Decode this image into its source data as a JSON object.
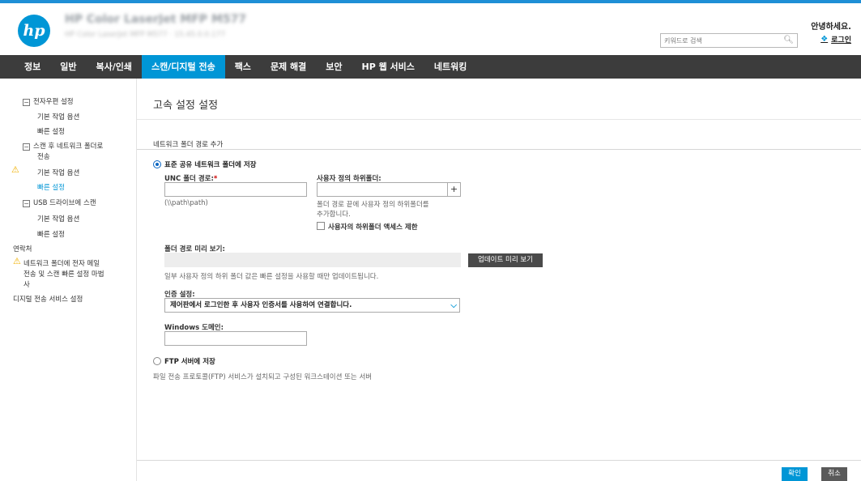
{
  "header": {
    "device_title": "HP Color LaserJet MFP M577",
    "device_subtitle": "HP Color LaserJet MFP M577 · 15.45.0.0.177",
    "greeting": "안녕하세요.",
    "search_placeholder": "키워드로 검색",
    "login_label": "로그인"
  },
  "nav": {
    "items": [
      "정보",
      "일반",
      "복사/인쇄",
      "스캔/디지털 전송",
      "팩스",
      "문제 해결",
      "보안",
      "HP 웹 서비스",
      "네트워킹"
    ],
    "active": "스캔/디지털 전송"
  },
  "sidebar": {
    "items": [
      {
        "label": "전자우편 설정",
        "box": "−"
      },
      {
        "label": "기본 작업 옵션"
      },
      {
        "label": "빠른 설정"
      },
      {
        "label": "스캔 후 네트워크 폴더로",
        "box": "−"
      },
      {
        "label": "전송"
      },
      {
        "label": "기본 작업 옵션",
        "warning": true
      },
      {
        "label": "빠른 설정",
        "active": true
      },
      {
        "label": "USB 드라이브에 스캔",
        "box": "−"
      },
      {
        "label": "기본 작업 옵션"
      },
      {
        "label": "빠른 설정"
      },
      {
        "label": "연락처"
      },
      {
        "label": "네트워크 폴더에 전자 메일",
        "warning": true
      },
      {
        "label": "전송 및 스캔 빠른 설정 마법"
      },
      {
        "label": "사"
      },
      {
        "label": "디지털 전송 서비스 설정"
      }
    ]
  },
  "main": {
    "title": "고속 설정 설정",
    "section_header": "네트워크 폴더 경로 추가",
    "option_standard": "표준 공유 네트워크 폴더에 저장",
    "unc_label": "UNC 폴더 경로:",
    "unc_required": "*",
    "unc_hint": "(\\\\path\\path)",
    "custom_subfolder_label": "사용자 정의 하위폴더:",
    "custom_subfolder_hint_line1": "폴더 경로 끝에 사용자 정의 하위폴더를",
    "custom_subfolder_hint_line2": "추가합니다.",
    "restrict_checkbox_label": "사용자의 하위폴더 액세스 제한",
    "preview_label": "폴더 경로 미리 보기:",
    "update_preview_button": "업데이트 미리 보기",
    "preview_note": "일부 사용자 정의 하위 폴더 값은 빠른 설정을 사용할 때만 업데이트됩니다.",
    "auth_label": "인증 설정:",
    "auth_value": "제어판에서 로그인한 후 사용자 인증서를 사용하여 연결합니다.",
    "windows_domain_label": "Windows 도메인:",
    "option_ftp": "FTP 서버에 저장",
    "ftp_desc": "파일 전송 프로토콜(FTP) 서비스가 설치되고 구성된 워크스테이션 또는 서버",
    "ok_button": "확인",
    "cancel_button": "취소"
  },
  "colors": {
    "accent": "#0096d6",
    "nav_bg": "#3c3c3c",
    "warning": "#f0b000"
  }
}
